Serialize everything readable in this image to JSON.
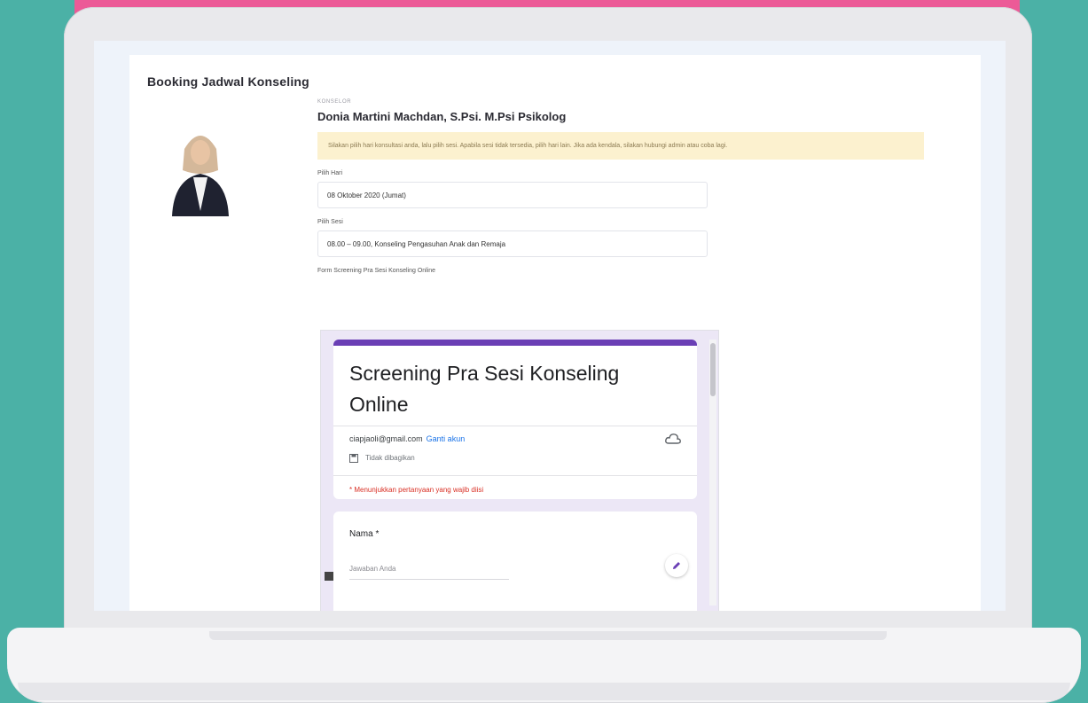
{
  "page": {
    "title": "Booking Jadwal Konseling"
  },
  "counselor": {
    "section_label": "Konselor",
    "name": "Donia Martini Machdan, S.Psi. M.Psi Psikolog"
  },
  "notice": {
    "text": "Silakan pilih hari konsultasi anda, lalu pilih sesi. Apabila sesi tidak tersedia, pilih hari lain. Jika ada kendala, silakan hubungi admin atau coba lagi."
  },
  "form": {
    "day_label": "Pilih Hari",
    "day_value": "08 Oktober 2020 (Jumat)",
    "session_label": "Pilih Sesi",
    "session_value": "08.00 – 09.00, Konseling Pengasuhan Anak dan Remaja",
    "screening_label": "Form Screening Pra Sesi Konseling Online"
  },
  "gform": {
    "title": "Screening Pra Sesi Konseling Online",
    "email": "ciapjaoli@gmail.com",
    "switch_account": "Ganti akun",
    "save_notice": "Tidak dibagikan",
    "required_notice": "* Menunjukkan pertanyaan yang wajib diisi",
    "question_label": "Nama *",
    "answer_placeholder": "Jawaban Anda"
  },
  "colors": {
    "background": "#4bb1a6",
    "accent_pink": "#ec5a97",
    "gform_purple": "#6a3fb5",
    "notice_bg": "#fcf1cf"
  },
  "icons": {
    "cloud": "cloud-upload-icon",
    "save": "save-icon",
    "edit": "pencil-icon"
  }
}
